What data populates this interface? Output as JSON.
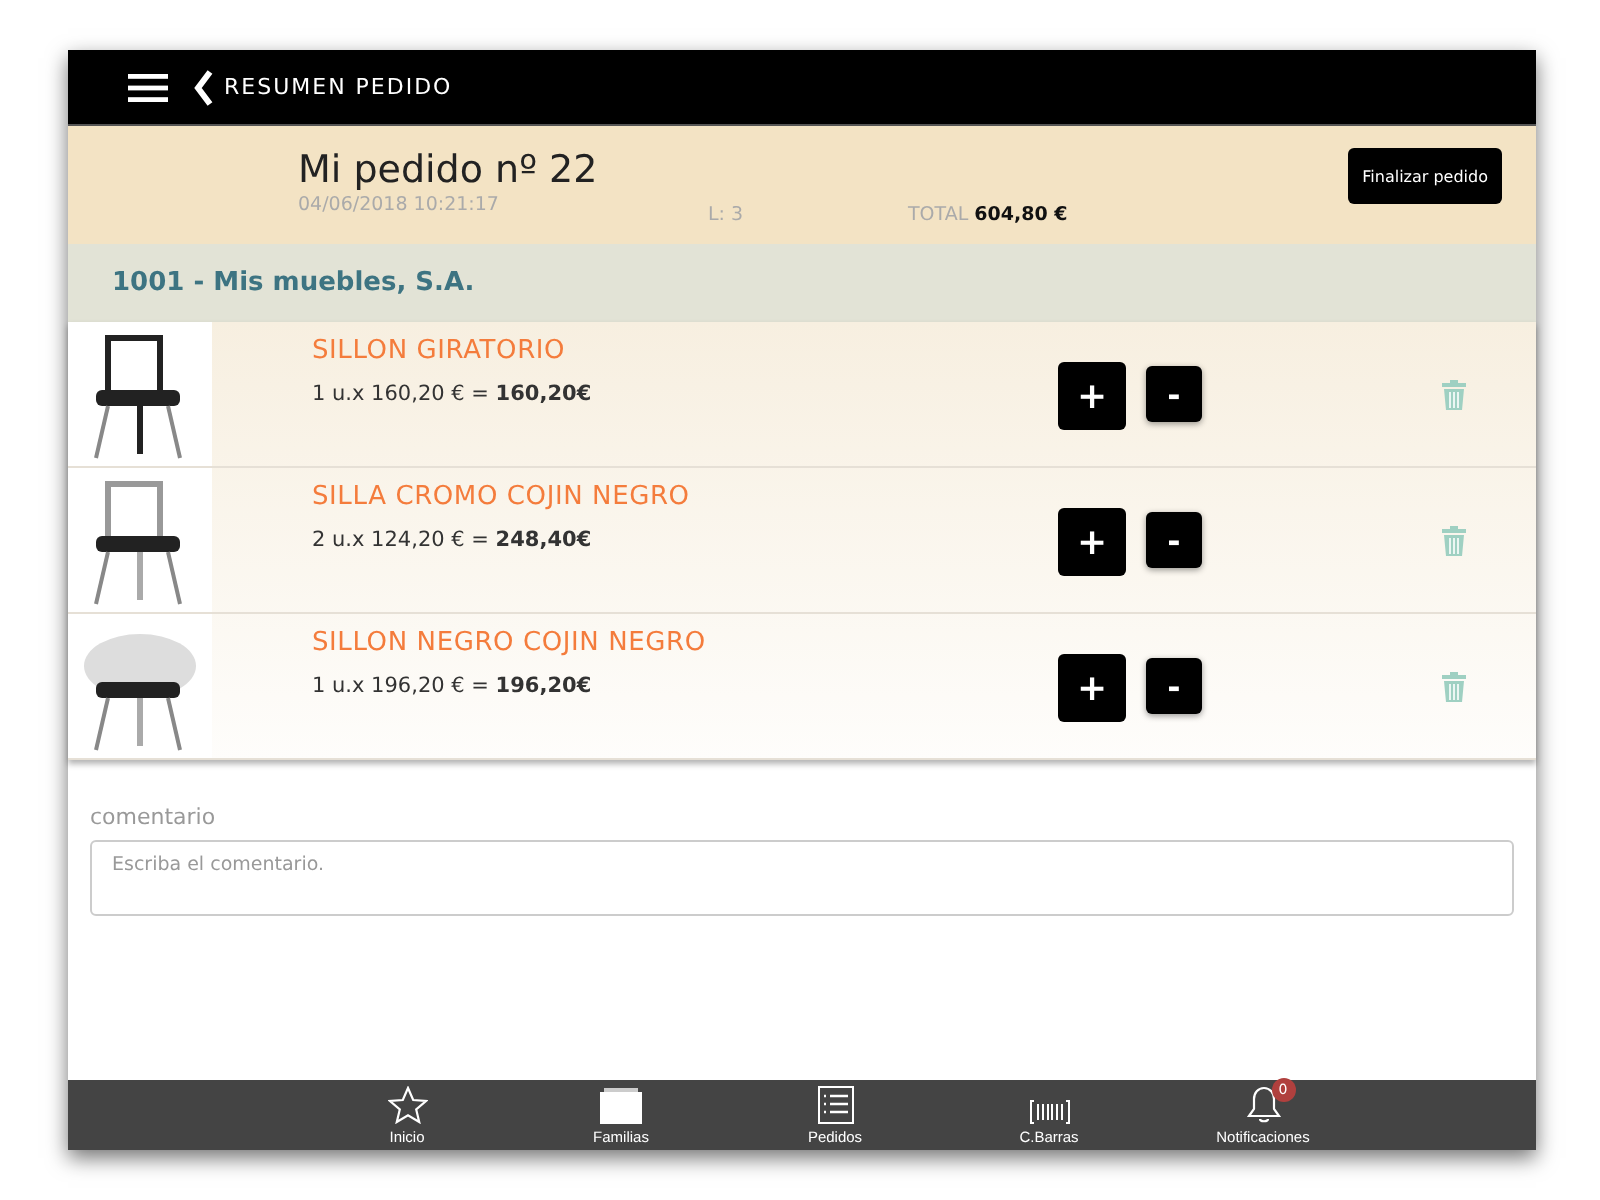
{
  "header": {
    "title": "RESUMEN PEDIDO"
  },
  "order": {
    "title": "Mi pedido nº 22",
    "date": "04/06/2018 10:21:17",
    "lines": "L: 3",
    "total_label": "TOTAL",
    "total": "604,80 €",
    "finish_button": "Finalizar pedido"
  },
  "client": "1001 - Mis muebles, S.A.",
  "items": [
    {
      "kind": "picture",
      "name": "SILLON GIRATORIO",
      "detail": "1  u.x 160,20 € =  **160,20€**",
      "plus": "+",
      "minus": "-"
    },
    {
      "kind": "picture",
      "name": "SILLA CROMO COJIN NEGRO",
      "detail": "2  u.x 124,20 € =  **248,40€**",
      "plus": "+",
      "minus": "-"
    },
    {
      "kind": "picture",
      "name": "SILLON NEGRO COJIN NEGRO",
      "detail": "1  u.x 196,20 € =  **196,20€**",
      "plus": "+",
      "minus": "-"
    }
  ],
  "comment": {
    "label": "comentario",
    "placeholder": "Escriba el comentario."
  },
  "tabs": [
    {
      "label": "Inicio",
      "kind": "star"
    },
    {
      "label": "Familias",
      "kind": "folder"
    },
    {
      "label": "Pedidos",
      "kind": "list"
    },
    {
      "label": "C.Barras",
      "kind": "barcode"
    },
    {
      "label": "Notificaciones",
      "kind": "bell",
      "badge": "0"
    }
  ]
}
